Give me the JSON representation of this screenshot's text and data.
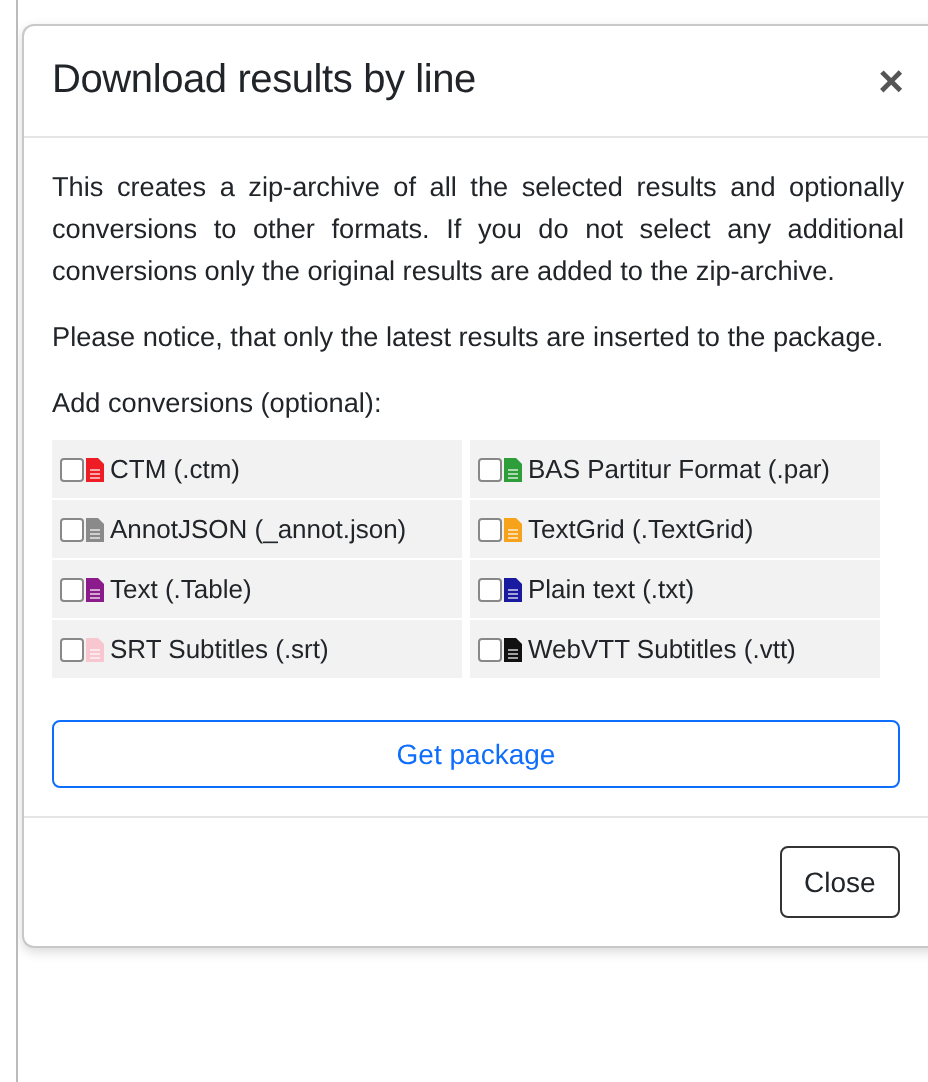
{
  "dialog": {
    "title": "Download results by line",
    "close_symbol": "×",
    "paragraphs": [
      "This creates a zip-archive of all the selected results and optionally conversions to other formats. If you do not select any additional conversions only the original results are added to the zip-archive.",
      "Please notice, that only the latest results are inserted to the package."
    ],
    "conversions_label": "Add conversions (optional):",
    "conversions": [
      {
        "label": "CTM (.ctm)",
        "checked": false,
        "color": "#ee1c25"
      },
      {
        "label": "BAS Partitur Format (.par)",
        "checked": false,
        "color": "#2e9e3a"
      },
      {
        "label": "AnnotJSON (_annot.json)",
        "checked": false,
        "color": "#8a8a8a"
      },
      {
        "label": "TextGrid (.TextGrid)",
        "checked": false,
        "color": "#f7a21b"
      },
      {
        "label": "Text (.Table)",
        "checked": false,
        "color": "#8b1a8b"
      },
      {
        "label": "Plain text (.txt)",
        "checked": false,
        "color": "#1a1aa0"
      },
      {
        "label": "SRT Subtitles (.srt)",
        "checked": false,
        "color": "#f7c6cf"
      },
      {
        "label": "WebVTT Subtitles (.vtt)",
        "checked": false,
        "color": "#111111"
      }
    ],
    "primary_button": "Get package",
    "footer_button": "Close"
  }
}
